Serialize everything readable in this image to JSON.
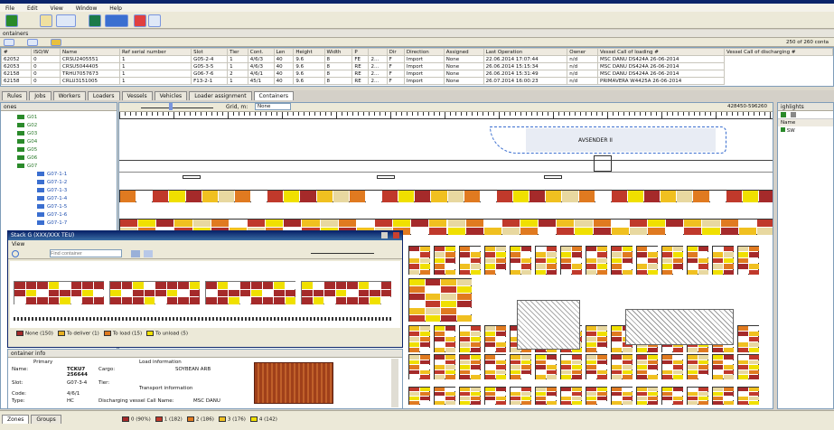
{
  "menu": [
    "File",
    "Edit",
    "View",
    "Window",
    "Help"
  ],
  "containers_panel": {
    "title": "ontainers",
    "count": "250 of 260 conta",
    "columns": [
      "#",
      "ISO/W",
      "Name",
      "Ref serial number",
      "Slot",
      "Tier",
      "Cont.",
      "Len",
      "Height",
      "Width",
      "P",
      "",
      "Dir",
      "Direction",
      "Assigned",
      "Last Operation",
      "Owner",
      "Vessel Call of loading #",
      "Vessel Call of discharging #"
    ],
    "rows": [
      [
        "62052",
        "0",
        "CRSU2405551",
        "1",
        "G05-2-4",
        "1",
        "4/6/3",
        "40",
        "9.6",
        "8",
        "FE",
        "2...",
        "F",
        "Import",
        "None",
        "22.06.2014 17:07:44",
        "n/d",
        "MSC DANU DS424A 26-06-2014"
      ],
      [
        "62053",
        "0",
        "CRSU5044405",
        "1",
        "G05-3-5",
        "1",
        "4/6/3",
        "40",
        "9.6",
        "8",
        "RE",
        "2...",
        "F",
        "Import",
        "None",
        "26.06.2014 15:15:34",
        "n/d",
        "MSC DANU DS424A 26-06-2014"
      ],
      [
        "62158",
        "0",
        "TRHU7057673",
        "1",
        "G06-7-6",
        "2",
        "4/6/1",
        "40",
        "9.6",
        "8",
        "RE",
        "2...",
        "F",
        "Import",
        "None",
        "26.06.2014 15:31:49",
        "n/d",
        "MSC DANU DS424A 26-06-2014"
      ],
      [
        "62158",
        "0",
        "CRLU3151005",
        "1",
        "F13-2-1",
        "1",
        "45/1",
        "40",
        "9.6",
        "8",
        "RE",
        "2...",
        "F",
        "Import",
        "None",
        "26.07.2014 16:00:23",
        "n/d",
        "PRIMAVERA W4425A 26-06-2014"
      ]
    ]
  },
  "main_tabs": [
    "Rules",
    "Jobs",
    "Workers",
    "Loaders",
    "Vessels",
    "Vehicles",
    "Loader assignment",
    "Containers"
  ],
  "yard_tree": {
    "title": "ones",
    "items": [
      {
        "label": "G01",
        "depth": 1
      },
      {
        "label": "G02",
        "depth": 1
      },
      {
        "label": "G03",
        "depth": 1
      },
      {
        "label": "G04",
        "depth": 1
      },
      {
        "label": "G05",
        "depth": 1
      },
      {
        "label": "G06",
        "depth": 1
      },
      {
        "label": "G07",
        "depth": 1
      },
      {
        "label": "G07-1-1",
        "depth": 2
      },
      {
        "label": "G07-1-2",
        "depth": 2
      },
      {
        "label": "G07-1-3",
        "depth": 2
      },
      {
        "label": "G07-1-4",
        "depth": 2
      },
      {
        "label": "G07-1-5",
        "depth": 2
      },
      {
        "label": "G07-1-6",
        "depth": 2
      },
      {
        "label": "G07-1-7",
        "depth": 2
      }
    ]
  },
  "map": {
    "grid_label": "Grid, m:",
    "grid_value": "None",
    "coords": "428450-596260",
    "vessel_label": "AVSENDER II"
  },
  "highlights": {
    "title": "ighlights",
    "col": "Name",
    "item": "SW"
  },
  "stack_dialog": {
    "title": "Stack G (XXX/XXX TEU)",
    "menu": "View",
    "search_placeholder": "Find container",
    "legend": [
      {
        "label": "None (150)",
        "color": "#a52a2a"
      },
      {
        "label": "To deliver (1)",
        "color": "#e8b020"
      },
      {
        "label": "To load (15)",
        "color": "#e07a20"
      },
      {
        "label": "To unload (5)",
        "color": "#f0e000"
      }
    ]
  },
  "container_info": {
    "title": "ontainer info",
    "primary_header": "Primary",
    "load_header": "Load information",
    "transport_header": "Transport information",
    "name_label": "Name:",
    "name_value": "TCKU7\n256644",
    "cargo_label": "Cargo:",
    "cargo_value": "SOYBEAN ARB",
    "slot_label": "Slot:",
    "slot_value": "G07-3-4",
    "tier_label": "Tier:",
    "code_label": "Code:",
    "code_value": "4/6/1",
    "type_label": "Type:",
    "type_value": "HC",
    "call_label": "Discharging vessel Call Name:",
    "call_value": "MSC DANU"
  },
  "status_bar": {
    "tabs": [
      "Zones",
      "Groups"
    ],
    "legend": [
      {
        "label": "0 (90%)",
        "color": "#a52a2a"
      },
      {
        "label": "1 (182)",
        "color": "#c0392b"
      },
      {
        "label": "2 (186)",
        "color": "#e07a20"
      },
      {
        "label": "3 (176)",
        "color": "#f0c020"
      },
      {
        "label": "4 (142)",
        "color": "#f0e000"
      }
    ]
  }
}
